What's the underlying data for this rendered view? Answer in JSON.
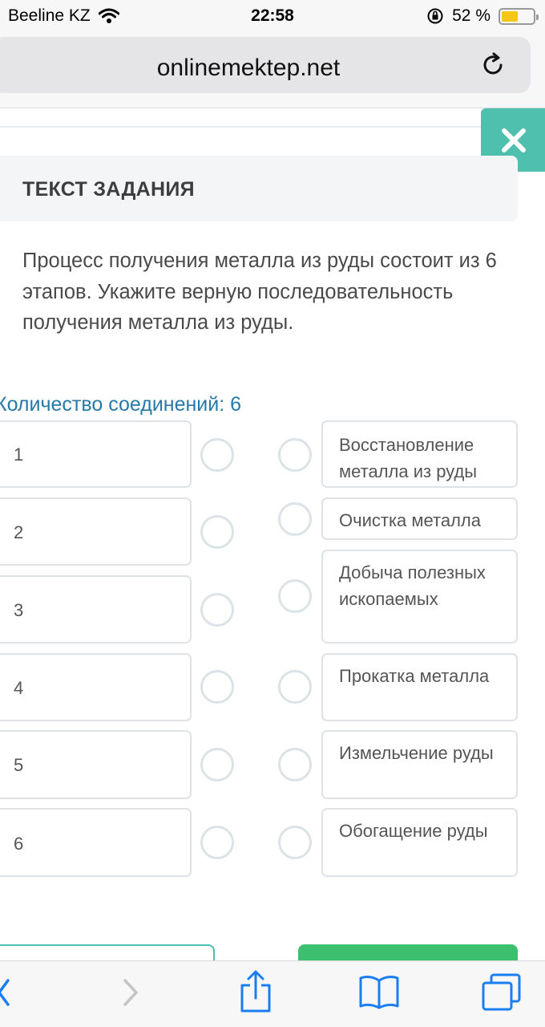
{
  "status_bar": {
    "carrier": "Beeline KZ",
    "time": "22:58",
    "battery": "52 %",
    "battery_level": 0.52
  },
  "browser": {
    "url": "onlinemektep.net"
  },
  "task": {
    "header": "ТЕКСТ ЗАДАНИЯ",
    "text": "Процесс получения металла из руды состоит из 6 этапов. Укажите верную последовательность получения металла из руды.",
    "connections_label": "Количество соединений: 6"
  },
  "left_items": [
    {
      "label": "1"
    },
    {
      "label": "2"
    },
    {
      "label": "3"
    },
    {
      "label": "4"
    },
    {
      "label": "5"
    },
    {
      "label": "6"
    }
  ],
  "right_items": [
    {
      "label": "Восстановление металла из руды"
    },
    {
      "label": "Очистка металла"
    },
    {
      "label": "Добыча полезных ископаемых"
    },
    {
      "label": "Прокатка металла"
    },
    {
      "label": "Измельчение руды"
    },
    {
      "label": "Обогащение руды"
    }
  ],
  "colors": {
    "accent_teal": "#4fbfae",
    "link_blue": "#2679a8",
    "button_green": "#3cc06f",
    "battery_yellow": "#f5c518"
  },
  "icons": {
    "wifi": "wifi-icon",
    "lock_rotation": "orientation-lock-icon",
    "reload": "reload-icon",
    "close": "close-icon",
    "back": "back-chevron-icon",
    "forward": "forward-chevron-icon",
    "share": "share-icon",
    "bookmarks": "bookmarks-icon",
    "tabs": "tabs-icon"
  }
}
